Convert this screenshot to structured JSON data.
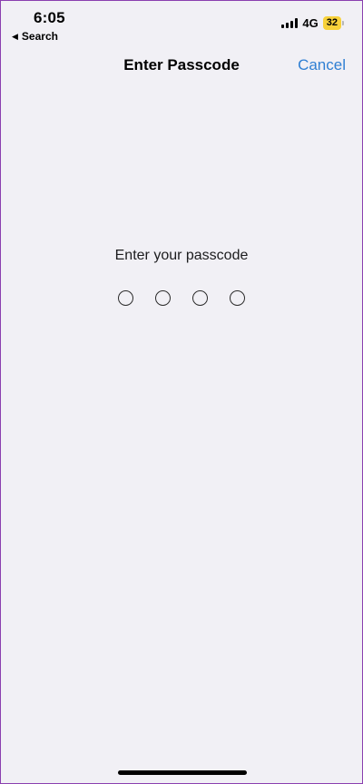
{
  "status_bar": {
    "time": "6:05",
    "back_label": "Search",
    "network": "4G",
    "battery": "32",
    "battery_color": "#f7d13a"
  },
  "nav": {
    "title": "Enter Passcode",
    "cancel_label": "Cancel",
    "accent_color": "#2f7fd3"
  },
  "passcode": {
    "prompt": "Enter your passcode",
    "digits_total": 4,
    "digits_entered": 0
  }
}
